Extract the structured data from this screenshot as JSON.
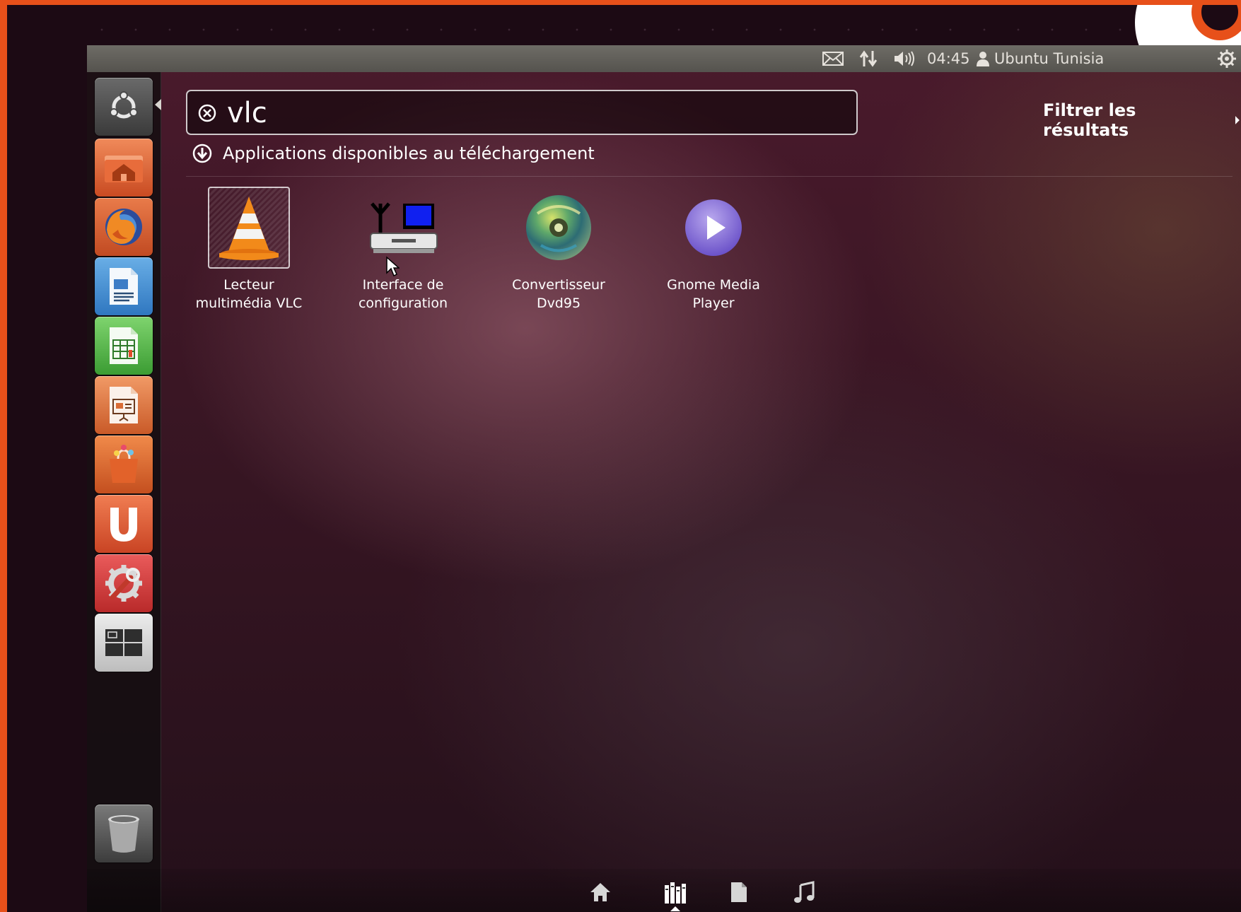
{
  "topbar": {
    "mail_icon": "envelope-icon",
    "network_icon": "network-updown-icon",
    "sound_icon": "speaker-icon",
    "clock": "04:45",
    "user_icon": "person-icon",
    "user_name": "Ubuntu Tunisia",
    "session_icon": "gear-icon"
  },
  "launcher": {
    "items": [
      {
        "name": "Dash",
        "icon": "ubuntu-logo-icon"
      },
      {
        "name": "Home folder",
        "icon": "home-folder-icon"
      },
      {
        "name": "Firefox",
        "icon": "firefox-icon"
      },
      {
        "name": "LibreOffice Writer",
        "icon": "writer-document-icon"
      },
      {
        "name": "LibreOffice Calc",
        "icon": "spreadsheet-icon"
      },
      {
        "name": "LibreOffice Impress",
        "icon": "presentation-icon"
      },
      {
        "name": "Ubuntu Software Center",
        "icon": "shopping-bag-icon"
      },
      {
        "name": "Ubuntu One",
        "icon": "ubuntu-one-icon"
      },
      {
        "name": "System Settings",
        "icon": "settings-wrench-icon"
      },
      {
        "name": "Workspace Switcher",
        "icon": "workspaces-icon"
      },
      {
        "name": "Trash",
        "icon": "trash-icon"
      }
    ],
    "colors": {
      "home": "#e2673a",
      "writer": "#3d8fd6",
      "calc": "#4fb548",
      "impress": "#d96c36",
      "software": "#e06a2e",
      "ubuntuone": "#dd5a2e",
      "settings": "#d23b3b"
    }
  },
  "search": {
    "value": "vlc",
    "clear_icon": "circle-x-icon"
  },
  "filter_label": "Filtrer les résultats",
  "category": {
    "icon": "download-circle-icon",
    "title": "Applications disponibles au téléchargement"
  },
  "results": [
    {
      "label": "Lecteur\nmultimédia VLC",
      "icon": "vlc-cone-icon",
      "selected": true
    },
    {
      "label": "Interface de\nconfiguration",
      "icon": "router-icon"
    },
    {
      "label": "Convertisseur\nDvd95",
      "icon": "disc-icon"
    },
    {
      "label": "Gnome Media\nPlayer",
      "icon": "play-button-icon"
    }
  ],
  "lenses": [
    {
      "name": "home",
      "icon": "home-icon"
    },
    {
      "name": "applications",
      "icon": "applications-icon",
      "active": true
    },
    {
      "name": "files",
      "icon": "file-icon"
    },
    {
      "name": "music",
      "icon": "music-note-icon"
    }
  ]
}
